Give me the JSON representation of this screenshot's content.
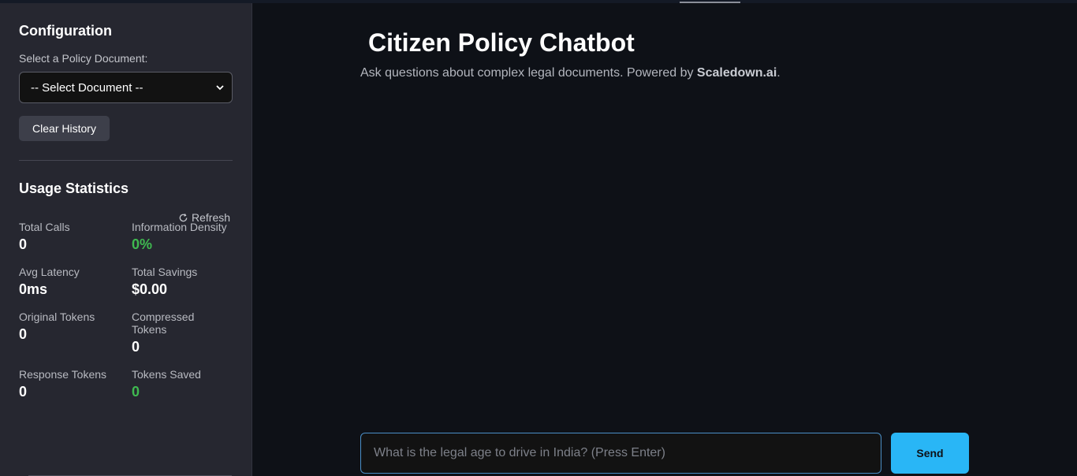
{
  "sidebar": {
    "config_title": "Configuration",
    "select_label": "Select a Policy Document:",
    "select_value": "-- Select Document --",
    "clear_button": "Clear History",
    "stats_title": "Usage Statistics",
    "refresh_label": "Refresh",
    "stats": {
      "total_calls": {
        "label": "Total Calls",
        "value": "0"
      },
      "info_density": {
        "label": "Information Density",
        "value": "0%"
      },
      "avg_latency": {
        "label": "Avg Latency",
        "value": "0ms"
      },
      "total_savings": {
        "label": "Total Savings",
        "value": "$0.00"
      },
      "original_tokens": {
        "label": "Original Tokens",
        "value": "0"
      },
      "compressed_tokens": {
        "label": "Compressed Tokens",
        "value": "0"
      },
      "response_tokens": {
        "label": "Response Tokens",
        "value": "0"
      },
      "tokens_saved": {
        "label": "Tokens Saved",
        "value": "0"
      }
    }
  },
  "main": {
    "title": "Citizen Policy Chatbot",
    "subtitle_prefix": "Ask questions about complex legal documents. Powered by ",
    "subtitle_brand": "Scaledown.ai",
    "subtitle_suffix": ".",
    "input_placeholder": "What is the legal age to drive in India? (Press Enter)",
    "send_label": "Send"
  },
  "colors": {
    "background": "#0e1117",
    "sidebar": "#262730",
    "accent": "#29b6f6",
    "positive": "#3fb950"
  }
}
